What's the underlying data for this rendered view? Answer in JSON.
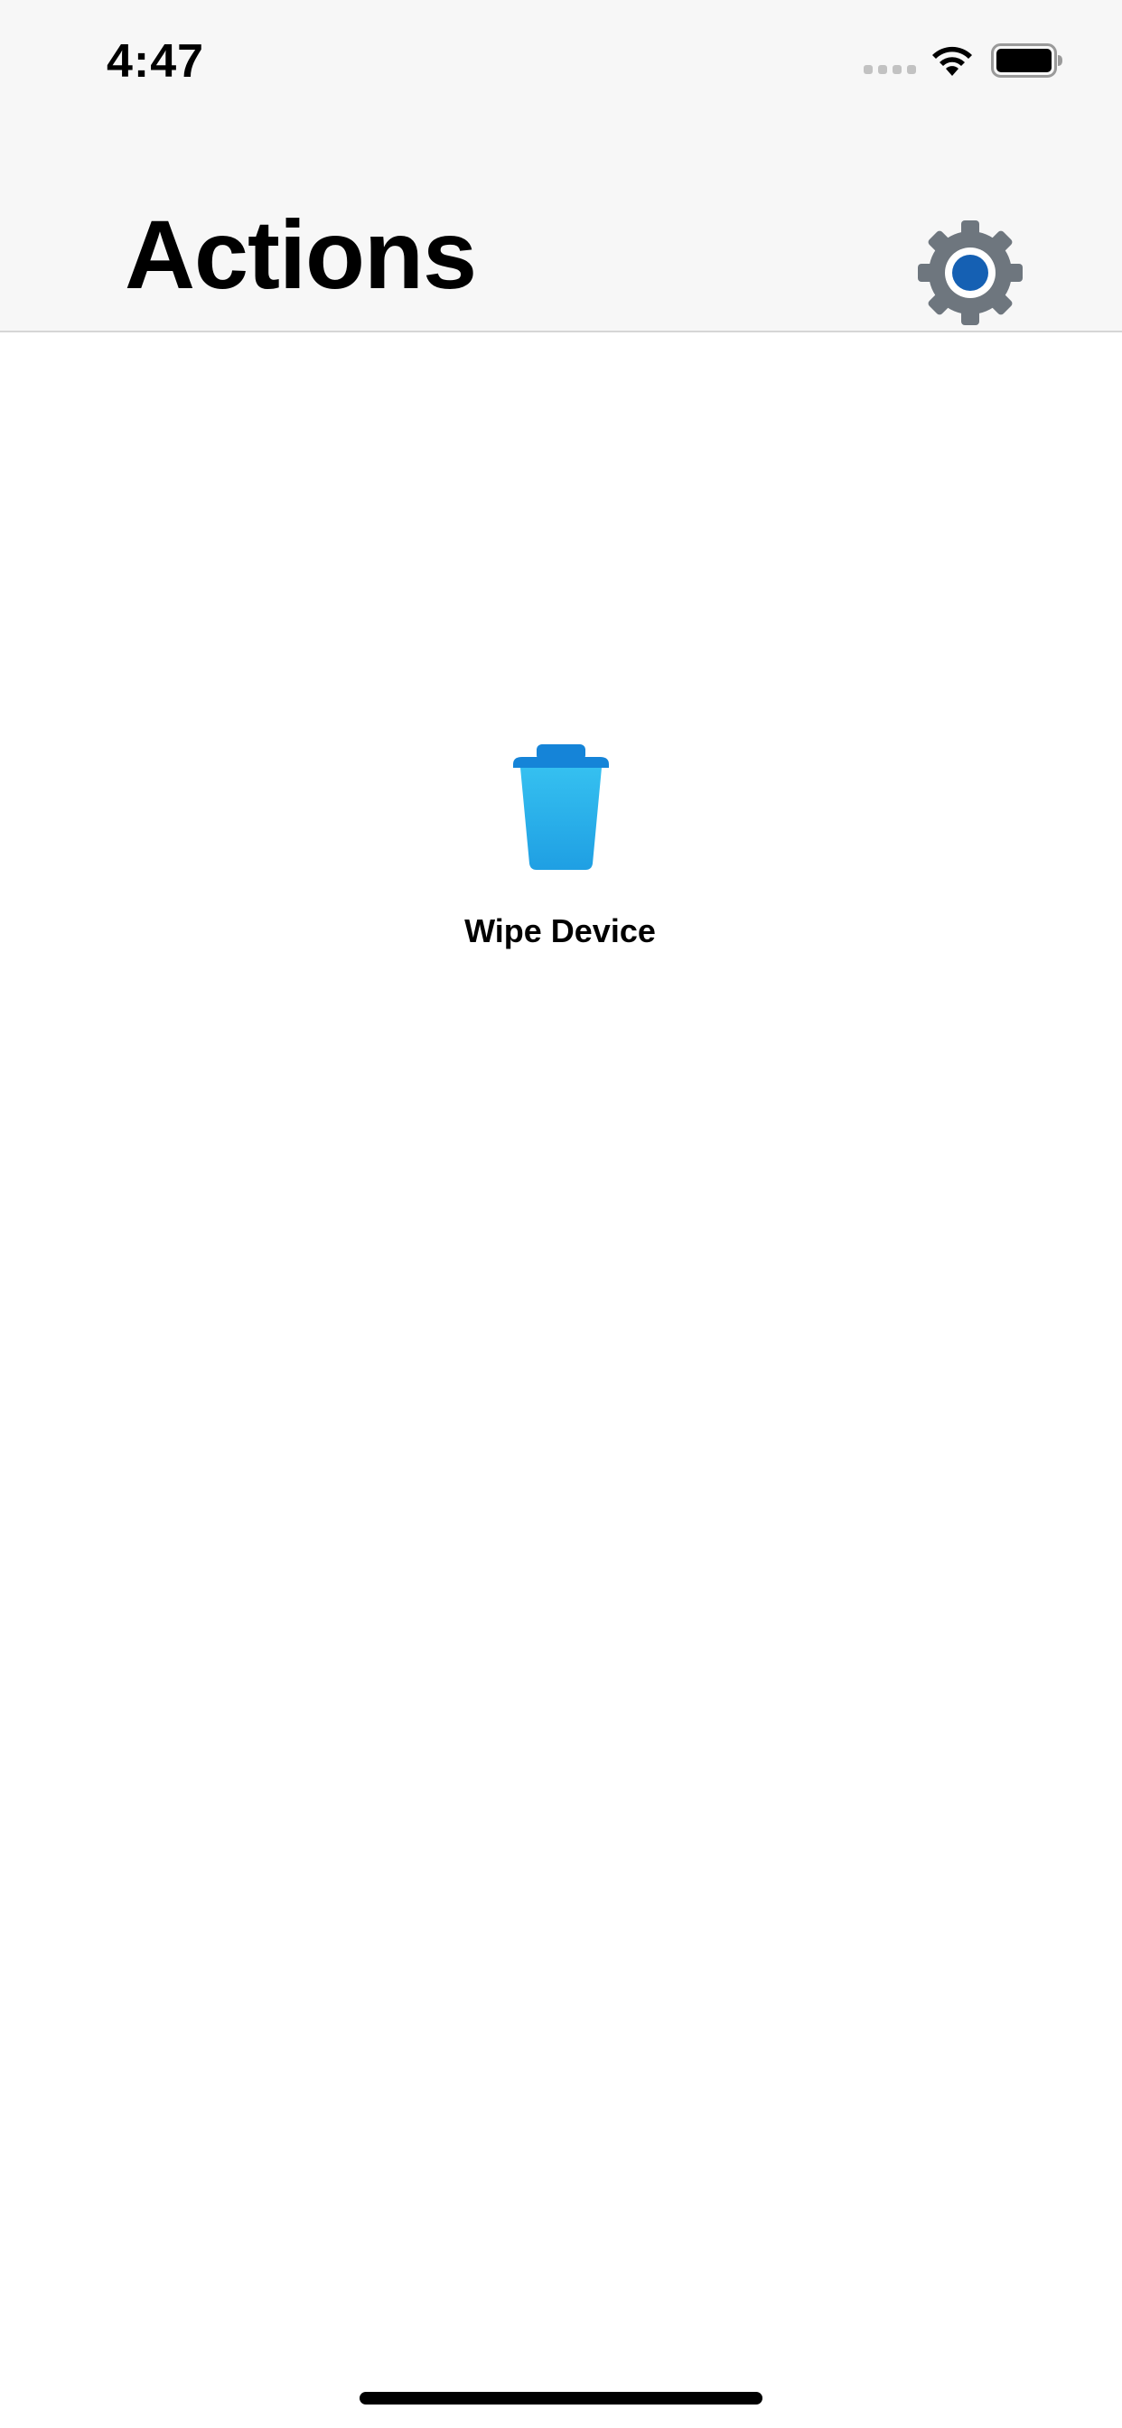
{
  "status_bar": {
    "time": "4:47"
  },
  "header": {
    "title": "Actions",
    "settings_icon": "gear-icon"
  },
  "actions": [
    {
      "label": "Wipe Device",
      "icon": "trash-icon"
    }
  ],
  "colors": {
    "nav_background": "#f7f7f7",
    "gear_gray": "#6e767e",
    "gear_center": "#1560b3",
    "trash_light": "#35c0f0",
    "trash_dark": "#1584d8"
  }
}
